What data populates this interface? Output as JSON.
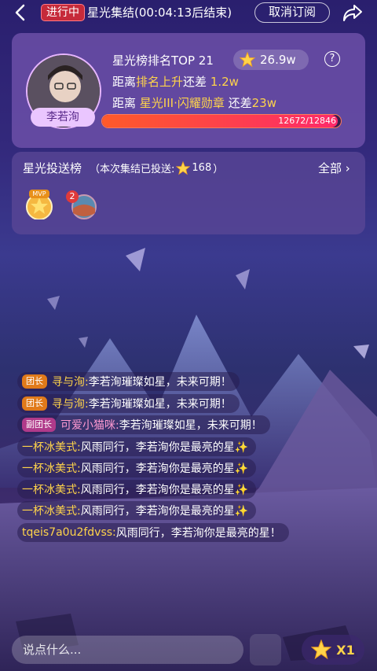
{
  "topbar": {
    "live_badge": "进行中",
    "title": "星光集结(00:04:13后结束)",
    "cancel_label": "取消订阅"
  },
  "rank_card": {
    "avatar_name": "李若洵",
    "rank_label": "星光榜排名TOP 21",
    "score": "26.9w",
    "help_symbol": "?",
    "line2_prefix": "距离",
    "line2_highlight": "排名上升",
    "line2_middle": "还差",
    "line2_value": "1.2w",
    "line3_prefix": "距离",
    "line3_highlight": "星光III·闪耀勋章",
    "line3_middle": "还差",
    "line3_value": "23w",
    "progress_text": "12672/12846",
    "progress_fraction": 0.986
  },
  "donor_card": {
    "title": "星光投送榜",
    "subtitle_prefix": "（本次集结已投送:",
    "subtitle_value": "168",
    "subtitle_suffix": "）",
    "all_label": "全部",
    "donors": [
      {
        "badge": "MVP"
      },
      {
        "badge": "2"
      }
    ]
  },
  "chat": {
    "messages": [
      {
        "role": "团长",
        "nick": "寻与洵:",
        "text": "李若洵璀璨如星，未来可期！"
      },
      {
        "role": "团长",
        "nick": "寻与洵:",
        "text": "李若洵璀璨如星，未来可期！"
      },
      {
        "role": "副团长",
        "nick": "可爱小猫咪:",
        "text": "李若洵璀璨如星，未来可期！"
      },
      {
        "role": "",
        "nick": "一杯冰美式:",
        "text": "风雨同行，李若洵你是最亮的星✨"
      },
      {
        "role": "",
        "nick": "一杯冰美式:",
        "text": "风雨同行，李若洵你是最亮的星✨"
      },
      {
        "role": "",
        "nick": "一杯冰美式:",
        "text": "风雨同行，李若洵你是最亮的星✨"
      },
      {
        "role": "",
        "nick": "一杯冰美式:",
        "text": "风雨同行，李若洵你是最亮的星✨"
      },
      {
        "role": "",
        "nick": "tqeis7a0u2fdvss:",
        "text": "风雨同行，李若洵你是最亮的星！"
      }
    ]
  },
  "bottom": {
    "input_placeholder": "说点什么...",
    "gift_count": "X1"
  },
  "colors": {
    "accent_gold": "#ffd44a",
    "live_red": "#c62a3a",
    "progress": "#ff3a5a"
  }
}
